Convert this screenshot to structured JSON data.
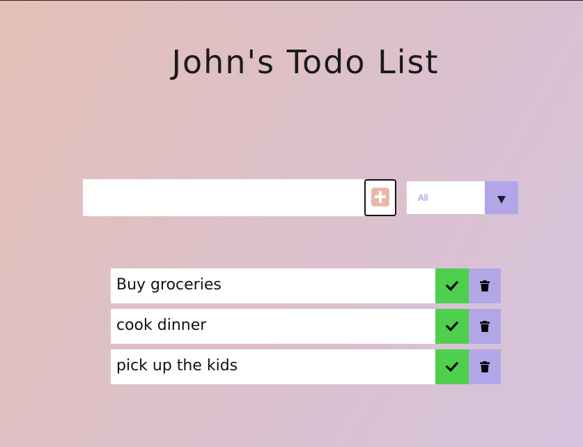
{
  "app": {
    "title": "John's Todo List"
  },
  "form": {
    "input_value": "",
    "input_placeholder": "",
    "add_icon": "plus-square-icon",
    "filter": {
      "selected": "All",
      "arrow_icon": "caret-down-icon"
    }
  },
  "todos": [
    {
      "text": "Buy groceries"
    },
    {
      "text": "cook dinner"
    },
    {
      "text": "pick up the kids"
    }
  ],
  "icons": {
    "complete": "check-icon",
    "delete": "trash-icon"
  },
  "colors": {
    "complete_button": "#4ecf4e",
    "delete_button": "#b2a6e8",
    "add_icon": "#e6b9a6",
    "filter_arrow_bg": "#b2a6e8"
  }
}
